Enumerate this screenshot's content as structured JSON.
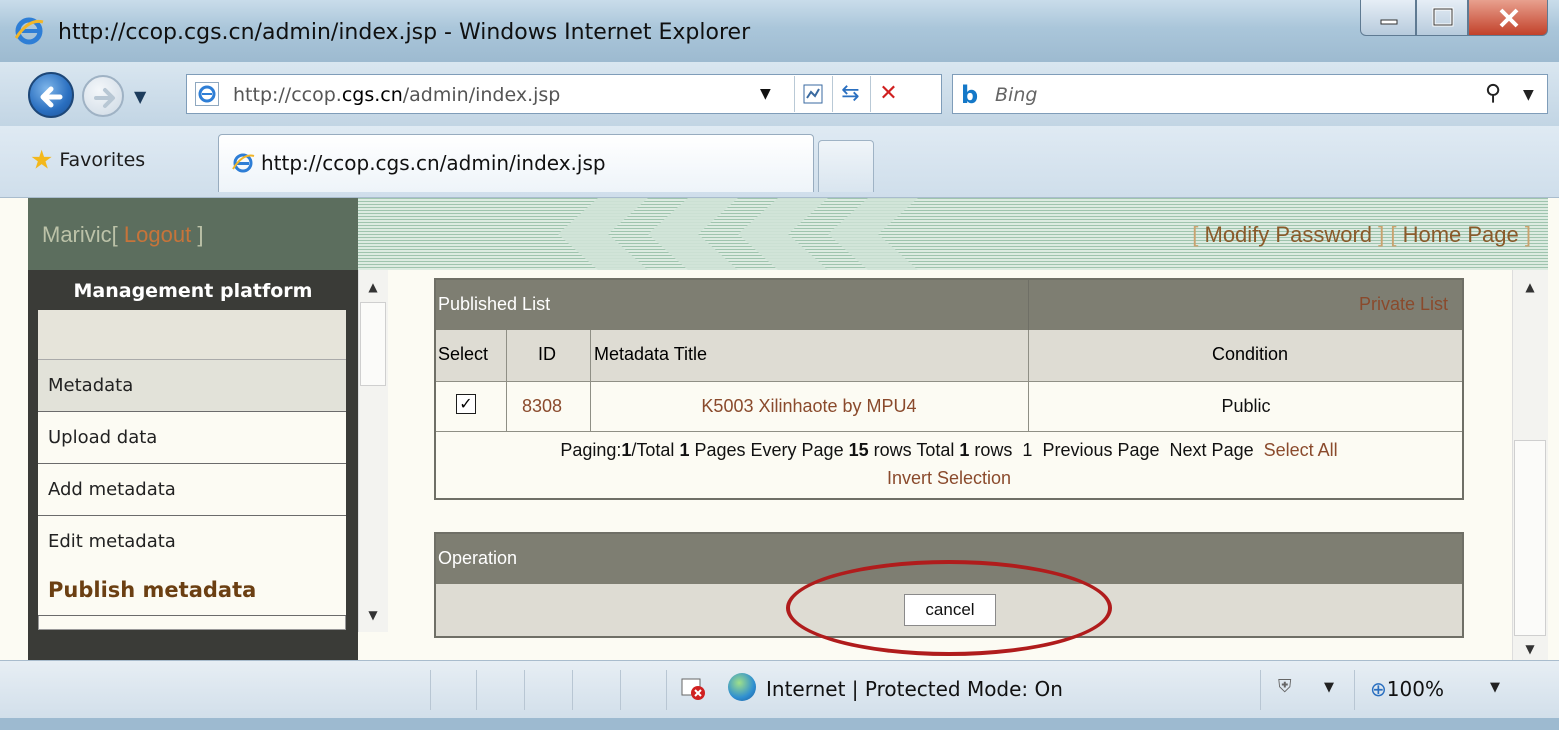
{
  "window": {
    "title": "http://ccop.cgs.cn/admin/index.jsp - Windows Internet Explorer"
  },
  "navbar": {
    "url_prefix": "http://ccop.",
    "url_domain": "cgs.cn",
    "url_suffix": "/admin/index.jsp",
    "search_placeholder": "Bing"
  },
  "favorites": {
    "label": "Favorites",
    "tab_title": "http://ccop.cgs.cn/admin/index.jsp"
  },
  "header": {
    "user": "Marivic",
    "bracket_open": "[ ",
    "logout": "Logout",
    "bracket_close": " ]",
    "modify_password": "Modify Password",
    "home_page": "Home Page",
    "link_open": "[ ",
    "link_sep": " ] [ ",
    "link_close": " ]"
  },
  "sidebar": {
    "title": "Management platform",
    "items": [
      {
        "label": "Metadata"
      },
      {
        "label": "Upload data"
      },
      {
        "label": "Add metadata"
      },
      {
        "label": "Edit metadata"
      },
      {
        "label": "Publish metadata"
      }
    ]
  },
  "published": {
    "title": "Published List",
    "private_link": "Private List",
    "columns": [
      "Select",
      "ID",
      "Metadata Title",
      "Condition"
    ],
    "rows": [
      {
        "checked": "✓",
        "id": "8308",
        "title": "K5003 Xilinhaote by MPU4",
        "condition": "Public"
      }
    ],
    "paging": {
      "p_label": "Paging:",
      "current": "1",
      "total_label": "/Total",
      "total_pages": "1",
      "pages_label": "Pages Every Page",
      "per_page": "15",
      "rows_label": "rows Total",
      "total_rows": "1",
      "rows_label2": "rows",
      "page_link": "1",
      "prev": "Previous Page",
      "next": "Next Page",
      "select_all": "Select All",
      "invert": "Invert Selection"
    }
  },
  "operation": {
    "title": "Operation",
    "cancel": "cancel"
  },
  "statusbar": {
    "zone": "Internet | Protected Mode: On",
    "zoom": "100%"
  },
  "colors": {
    "header_bg": "#5c6e5e",
    "panel_head": "#7e7e72",
    "accent_link": "#8a4a2c",
    "highlight_ellipse": "#b01c1c"
  }
}
